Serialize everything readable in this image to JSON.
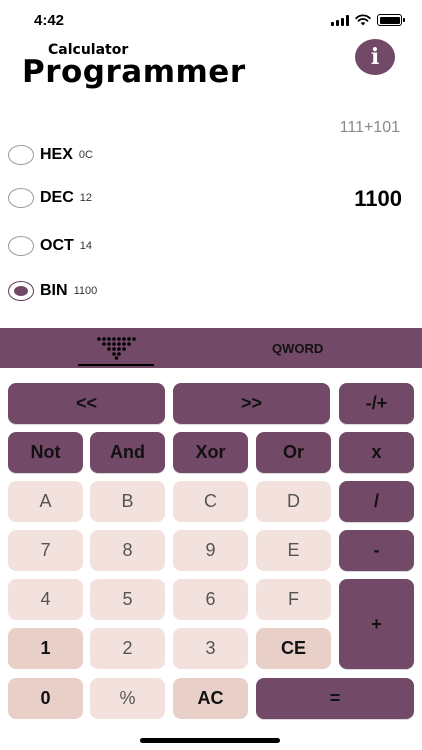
{
  "status_bar": {
    "time": "4:42"
  },
  "header": {
    "subtitle": "Calculator",
    "title": "Programmer",
    "info_icon": "info-icon",
    "info_label": "i"
  },
  "display": {
    "expression": "111+101",
    "result": "1100"
  },
  "radix": [
    {
      "name": "HEX",
      "value": "0C",
      "selected": false
    },
    {
      "name": "DEC",
      "value": "12",
      "selected": false
    },
    {
      "name": "OCT",
      "value": "14",
      "selected": false
    },
    {
      "name": "BIN",
      "value": "1100",
      "selected": true
    }
  ],
  "tabs": {
    "bit_keypad_icon": "bit-keypad-icon",
    "word_size": "QWORD"
  },
  "keys": {
    "lsh": "<<",
    "rsh": ">>",
    "negate": "-/+",
    "not": "Not",
    "and": "And",
    "xor": "Xor",
    "or": "Or",
    "multiply": "x",
    "a": "A",
    "b": "B",
    "c": "C",
    "d": "D",
    "divide": "/",
    "seven": "7",
    "eight": "8",
    "nine": "9",
    "e": "E",
    "minus": "-",
    "four": "4",
    "five": "5",
    "six": "6",
    "f": "F",
    "plus": "+",
    "one": "1",
    "two": "2",
    "three": "3",
    "ce": "CE",
    "zero": "0",
    "percent": "%",
    "ac": "AC",
    "equals": "="
  },
  "colors": {
    "accent": "#734968",
    "key_light": "#f3e1dd",
    "key_mid": "#e8cfc8"
  }
}
